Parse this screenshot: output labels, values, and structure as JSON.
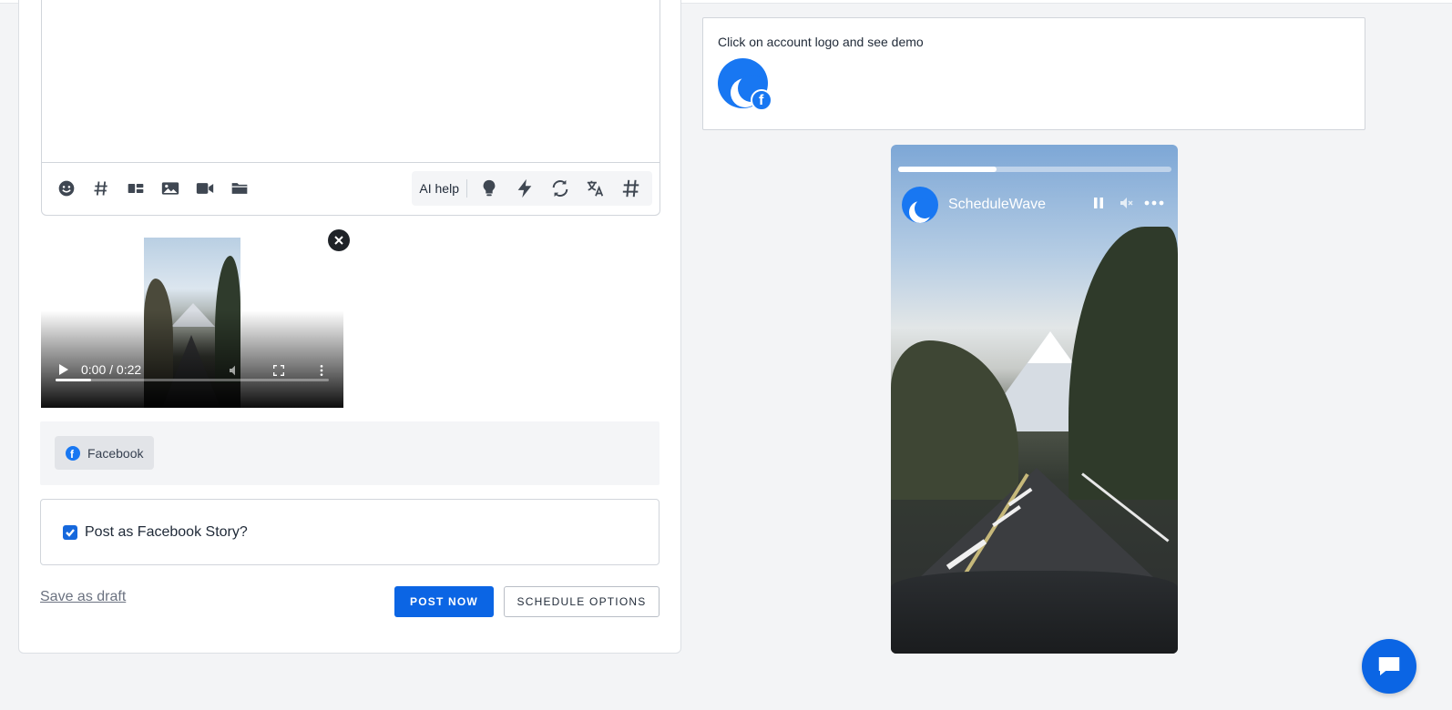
{
  "editor": {
    "text_value": "",
    "toolbar_icons": [
      "emoji-icon",
      "hashtag-icon",
      "template-icon",
      "image-icon",
      "video-icon",
      "folder-icon"
    ],
    "ai_help_label": "AI help",
    "ai_icons": [
      "idea-icon",
      "lightning-icon",
      "rephrase-icon",
      "translate-icon",
      "hashtag-generate-icon"
    ]
  },
  "media": {
    "video_time": "0:00 / 0:22",
    "video_progress": 0.13
  },
  "accounts": {
    "selected": [
      {
        "label": "Facebook",
        "network": "facebook"
      }
    ]
  },
  "options": {
    "story_label": "Post as Facebook Story?",
    "story_checked": true
  },
  "actions": {
    "save_draft": "Save as draft",
    "post_now": "POST NOW",
    "schedule": "SCHEDULE OPTIONS"
  },
  "preview": {
    "hint": "Click on account logo and see demo",
    "account_name": "ScheduleWave",
    "story_progress": 0.36
  },
  "colors": {
    "primary": "#0b65e4",
    "facebook": "#1877f2"
  }
}
